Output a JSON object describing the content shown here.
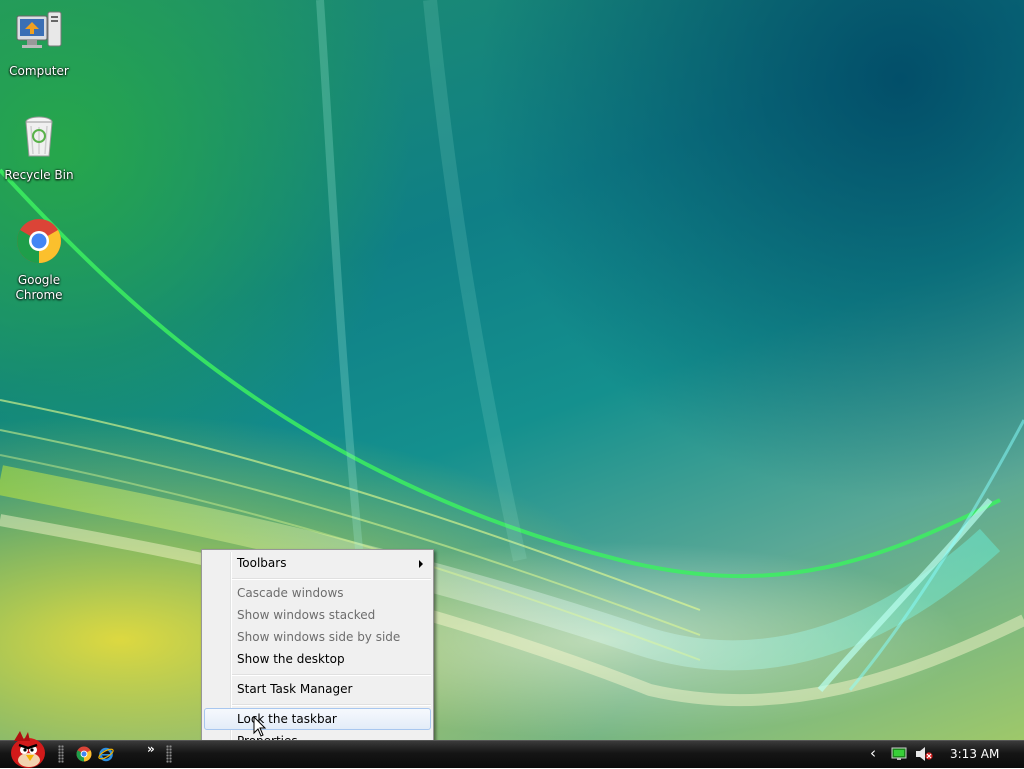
{
  "desktop": {
    "icons": [
      {
        "label": "Computer"
      },
      {
        "label": "Recycle Bin"
      },
      {
        "label": "Google Chrome"
      }
    ]
  },
  "context_menu": {
    "items": [
      {
        "label": "Toolbars",
        "enabled": true,
        "submenu": true
      },
      {
        "label": "Cascade windows",
        "enabled": false
      },
      {
        "label": "Show windows stacked",
        "enabled": false
      },
      {
        "label": "Show windows side by side",
        "enabled": false
      },
      {
        "label": "Show the desktop",
        "enabled": true
      },
      {
        "label": "Start Task Manager",
        "enabled": true
      },
      {
        "label": "Lock the taskbar",
        "enabled": true,
        "hovered": true
      },
      {
        "label": "Properties",
        "enabled": true
      }
    ]
  },
  "taskbar": {
    "quick_launch": {
      "icons": [
        "google-chrome-icon",
        "internet-explorer-icon"
      ],
      "more_label": "»"
    },
    "tray": {
      "expand_label": "‹",
      "icons": [
        "network-icon",
        "volume-muted-icon"
      ],
      "clock": "3:13 AM"
    }
  },
  "colors": {
    "menu_background": "#f0f0f0",
    "menu_highlight_border": "#a8c7ef",
    "disabled_text": "#6d6d6d",
    "taskbar": "#151515"
  }
}
